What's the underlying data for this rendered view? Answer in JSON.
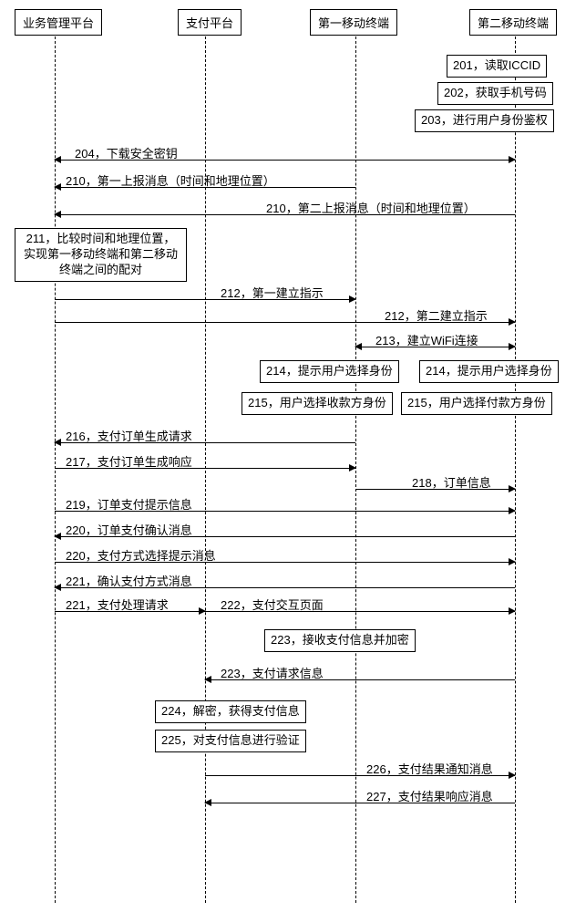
{
  "participants": {
    "p1": "业务管理平台",
    "p2": "支付平台",
    "p3": "第一移动终端",
    "p4": "第二移动终端"
  },
  "notes": {
    "n201": "201，读取ICCID",
    "n202": "202，获取手机号码",
    "n203": "203，进行用户身份鉴权",
    "n211": "211，比较时间和地理位置，实现第一移动终端和第二移动终端之间的配对",
    "n214a": "214，提示用户选择身份",
    "n214b": "214，提示用户选择身份",
    "n215a": "215，用户选择收款方身份",
    "n215b": "215，用户选择付款方身份",
    "n223b": "223，接收支付信息并加密",
    "n224": "224，解密，获得支付信息",
    "n225": "225，对支付信息进行验证"
  },
  "messages": {
    "m204": "204，下载安全密钥",
    "m210a": "210，第一上报消息（时间和地理位置）",
    "m210b": "210，第二上报消息（时间和地理位置）",
    "m212a": "212，第一建立指示",
    "m212b": "212，第二建立指示",
    "m213": "213，建立WiFi连接",
    "m216": "216，支付订单生成请求",
    "m217": "217，支付订单生成响应",
    "m218": "218，订单信息",
    "m219": "219，订单支付提示信息",
    "m220a": "220，订单支付确认消息",
    "m220b": "220，支付方式选择提示消息",
    "m221a": "221，确认支付方式消息",
    "m221b": "221，支付处理请求",
    "m222": "222，支付交互页面",
    "m223a": "223，支付请求信息",
    "m226": "226，支付结果通知消息",
    "m227": "227，支付结果响应消息"
  }
}
